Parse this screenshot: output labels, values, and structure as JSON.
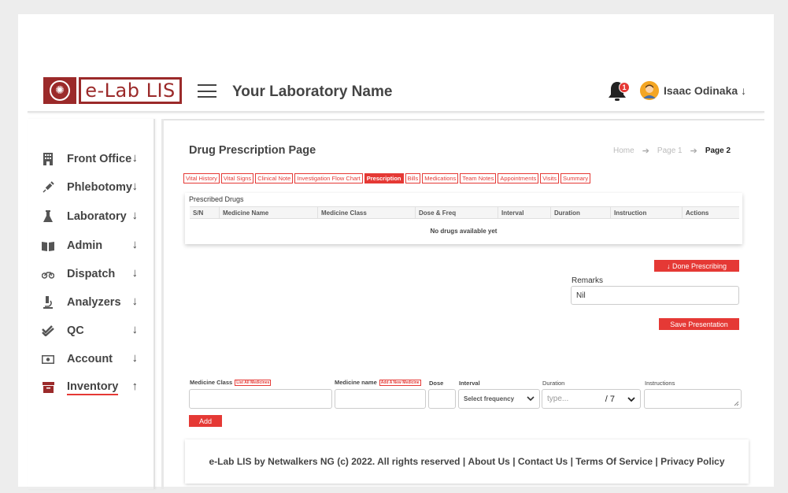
{
  "header": {
    "logo_text": "e-Lab LIS",
    "lab_name": "Your Laboratory Name",
    "notification_count": "1",
    "user_name": "Isaac Odinaka",
    "user_arrow": "↓"
  },
  "sidebar": {
    "items": [
      {
        "label": "Front Office",
        "arrow": "↓",
        "icon": "building-icon"
      },
      {
        "label": "Phlebotomy",
        "arrow": "↓",
        "icon": "syringe-icon"
      },
      {
        "label": "Laboratory",
        "arrow": "↓",
        "icon": "flask-icon"
      },
      {
        "label": "Admin",
        "arrow": "↓",
        "icon": "book-icon"
      },
      {
        "label": "Dispatch",
        "arrow": "↓",
        "icon": "motorcycle-icon"
      },
      {
        "label": "Analyzers",
        "arrow": "↓",
        "icon": "microscope-icon"
      },
      {
        "label": "QC",
        "arrow": "↓",
        "icon": "check-double-icon"
      },
      {
        "label": "Account",
        "arrow": "↓",
        "icon": "money-icon"
      },
      {
        "label": "Inventory",
        "arrow": "↑",
        "icon": "archive-icon"
      }
    ]
  },
  "main": {
    "title": "Drug Prescription Page",
    "breadcrumb": [
      "Home",
      "Page 1",
      "Page 2"
    ],
    "tabs": [
      "Vital History",
      "Vital Signs",
      "Clinical Note",
      "Investigation Flow Chart",
      "Prescription",
      "Bills",
      "Medications",
      "Team Notes",
      "Appointments",
      "Visits",
      "Summary"
    ],
    "active_tab": "Prescription",
    "prescribed": {
      "title": "Prescribed Drugs",
      "columns": [
        "S/N",
        "Medicine Name",
        "Medicine Class",
        "Dose & Freq",
        "Interval",
        "Duration",
        "Instruction",
        "Actions"
      ],
      "empty_message": "No drugs available yet"
    },
    "done_button": "↓ Done Prescribing",
    "remarks_label": "Remarks",
    "remarks_value": "Nil",
    "save_button": "Save Presentation",
    "form": {
      "medicine_class_label": "Medicine Class",
      "list_all_button": "List All Medicines",
      "medicine_name_label": "Medicine name",
      "add_new_button": "Add A New Medicine",
      "dose_label": "Dose",
      "interval_label": "Interval",
      "interval_value": "Select frequency",
      "duration_label": "Duration",
      "duration_placeholder": "type...",
      "duration_unit": "/ 7",
      "instructions_label": "Instructions",
      "add_button": "Add"
    }
  },
  "footer": {
    "copyright": "e-Lab LIS by Netwalkers NG (c) 2022. All rights reserved",
    "links": [
      "About Us",
      "Contact Us",
      "Terms Of Service",
      "Privacy Policy"
    ],
    "separator": " | "
  },
  "colors": {
    "brand": "#9b2a2a",
    "accent": "#e53935"
  }
}
